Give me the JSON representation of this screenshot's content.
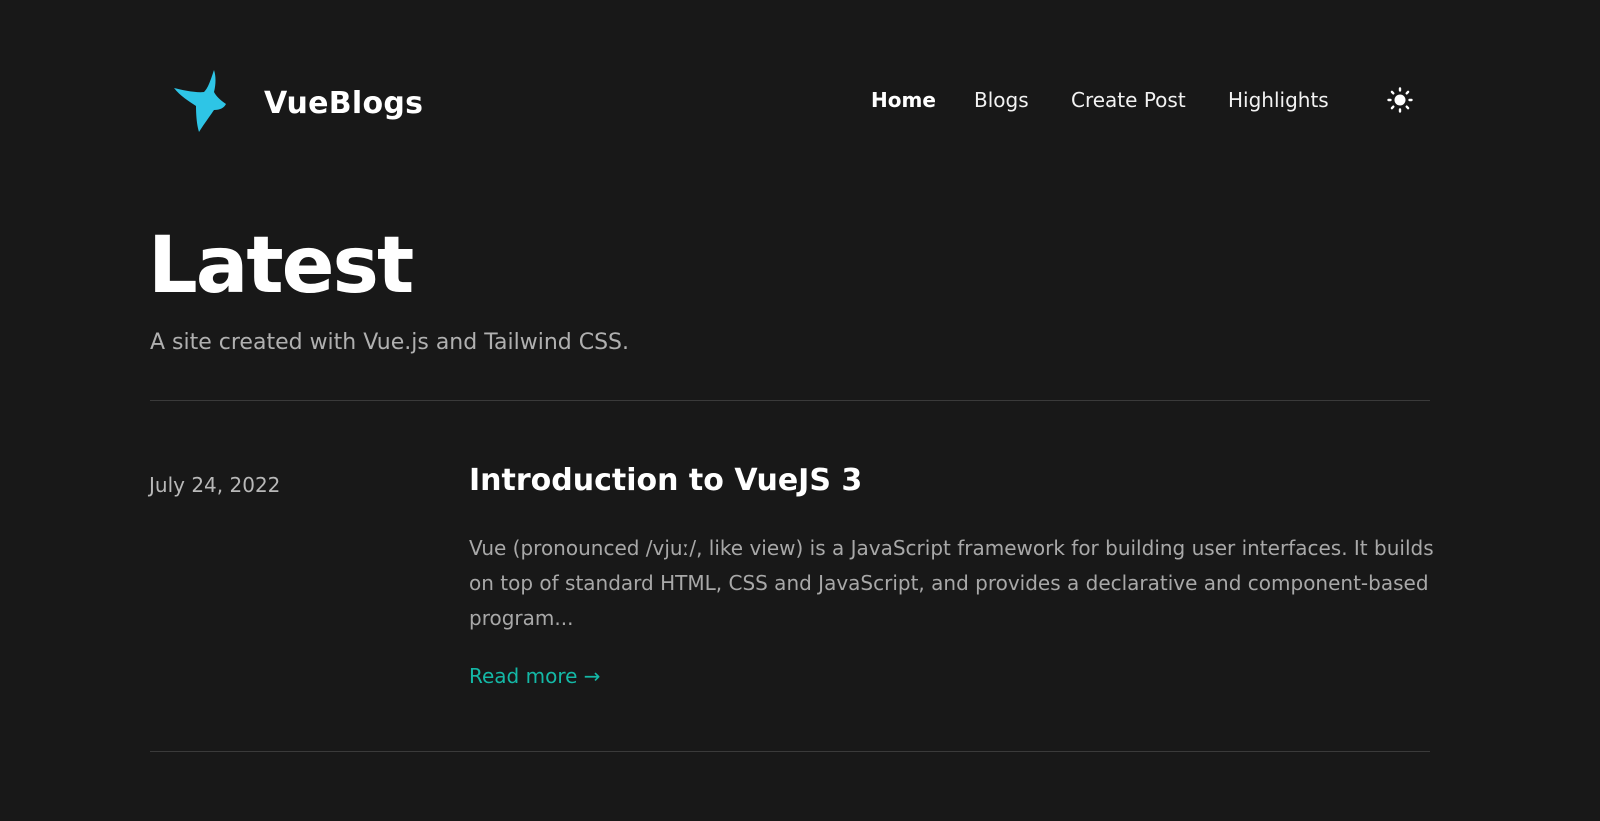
{
  "header": {
    "brand": "VueBlogs",
    "logo_icon": "star-logo-icon",
    "accent_logo_color": "#2ec5e6",
    "nav": [
      {
        "label": "Home",
        "active": true
      },
      {
        "label": "Blogs",
        "active": false
      },
      {
        "label": "Create Post",
        "active": false
      },
      {
        "label": "Highlights",
        "active": false
      }
    ],
    "theme_toggle_icon": "sun-icon"
  },
  "main": {
    "title": "Latest",
    "subtitle": "A site created with Vue.js and Tailwind CSS.",
    "posts": [
      {
        "date": "July 24, 2022",
        "title": "Introduction to VueJS 3",
        "excerpt": "Vue (pronounced /vjuː/, like view) is a JavaScript framework for building user interfaces. It builds on top of standard HTML, CSS and JavaScript, and provides a declarative and component-based program...",
        "read_more": "Read more →"
      }
    ]
  },
  "colors": {
    "background": "#181818",
    "accent": "#14b8a6"
  }
}
